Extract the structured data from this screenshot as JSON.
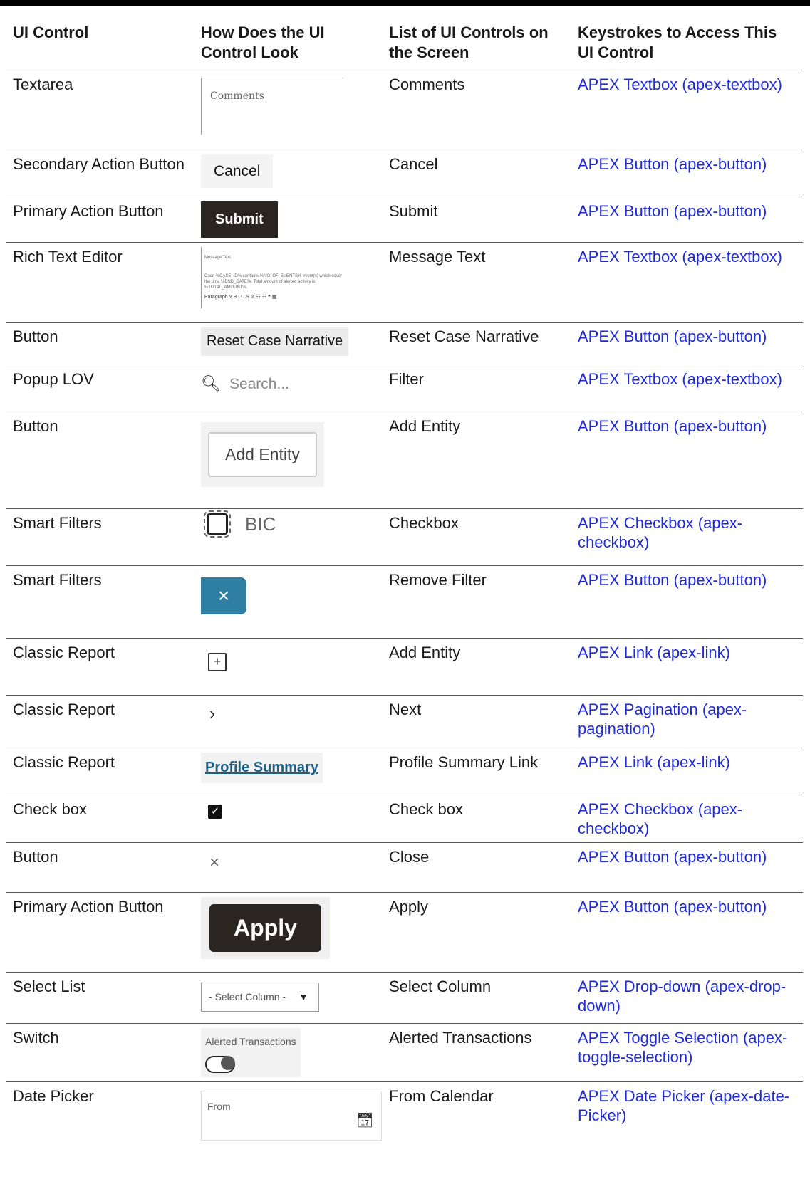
{
  "header": {
    "col1": "UI Control",
    "col2": "How Does the UI Control Look",
    "col3": "List of UI Controls on the Screen",
    "col4": "Keystrokes to Access This UI Control"
  },
  "rows": [
    {
      "control": "Textarea",
      "look": "Comments",
      "name": "Comments",
      "keys": "APEX Textbox (apex-textbox)"
    },
    {
      "control": "Secondary Action Button",
      "look": "Cancel",
      "name": "Cancel",
      "keys": "APEX Button (apex-button)"
    },
    {
      "control": "Primary Action Button",
      "look": "Submit",
      "name": "Submit",
      "keys": "APEX Button (apex-button)"
    },
    {
      "control": "Rich Text Editor",
      "look": "Message Text",
      "name": "Message Text",
      "keys": "APEX Textbox (apex-textbox)"
    },
    {
      "control": "Button",
      "look": "Reset Case Narrative",
      "name": "Reset Case Narrative",
      "keys": "APEX Button (apex-button)"
    },
    {
      "control": "Popup LOV",
      "look": "Search...",
      "name": "Filter",
      "keys": "APEX Textbox (apex-textbox)"
    },
    {
      "control": "Button",
      "look": "Add Entity",
      "name": "Add Entity",
      "keys": "APEX Button (apex-button)"
    },
    {
      "control": "Smart Filters",
      "look": "BIC",
      "name": "Checkbox",
      "keys": "APEX Checkbox (apex-checkbox)"
    },
    {
      "control": "Smart Filters",
      "look": "×",
      "name": "Remove Filter",
      "keys": "APEX Button (apex-button)"
    },
    {
      "control": "Classic Report",
      "look": "+",
      "name": "Add Entity",
      "keys": "APEX Link (apex-link)"
    },
    {
      "control": "Classic Report",
      "look": "›",
      "name": "Next",
      "keys": "APEX Pagination (apex-pagination)"
    },
    {
      "control": "Classic Report",
      "look": "Profile Summary",
      "name": "Profile Summary Link",
      "keys": "APEX Link (apex-link)"
    },
    {
      "control": "Check box",
      "look": "✓",
      "name": "Check box",
      "keys": "APEX Checkbox (apex-checkbox)"
    },
    {
      "control": "Button",
      "look": "×",
      "name": "Close",
      "keys": "APEX Button (apex-button)"
    },
    {
      "control": "Primary Action Button",
      "look": "Apply",
      "name": "Apply",
      "keys": "APEX Button (apex-button)"
    },
    {
      "control": "Select List",
      "look": "- Select Column -",
      "name": "Select Column",
      "keys": "APEX Drop-down (apex-drop-down)"
    },
    {
      "control": "Switch",
      "look": "Alerted Transactions",
      "name": "Alerted Transactions",
      "keys": "APEX Toggle Selection (apex-toggle-selection)"
    },
    {
      "control": "Date Picker",
      "look": "From",
      "name": "From Calendar",
      "keys": "APEX Date Picker (apex-date-Picker)"
    }
  ],
  "rte": {
    "label": "Message Text",
    "body": "Case %CASE_ID% contains %NO_OF_EVENTS% event(s) which cover the time %END_DATE%. Total amount of alerted activity is %TOTAL_AMOUNT%.",
    "toolbar": "Paragraph   ˅  B  I  U  S  ⊘  ☷  ☷  ❝  ▦"
  },
  "icons": {
    "search": "search-icon",
    "checkbox": "checkbox-icon",
    "remove": "close-icon",
    "add": "plus-icon",
    "next": "chevron-right-icon",
    "check": "check-icon",
    "close": "close-icon",
    "caret": "caret-down-icon",
    "calendar": "calendar-icon"
  },
  "colors": {
    "link": "#1f2bd9",
    "primary_button": "#2b2522",
    "remove_filter": "#2e7fa1"
  }
}
